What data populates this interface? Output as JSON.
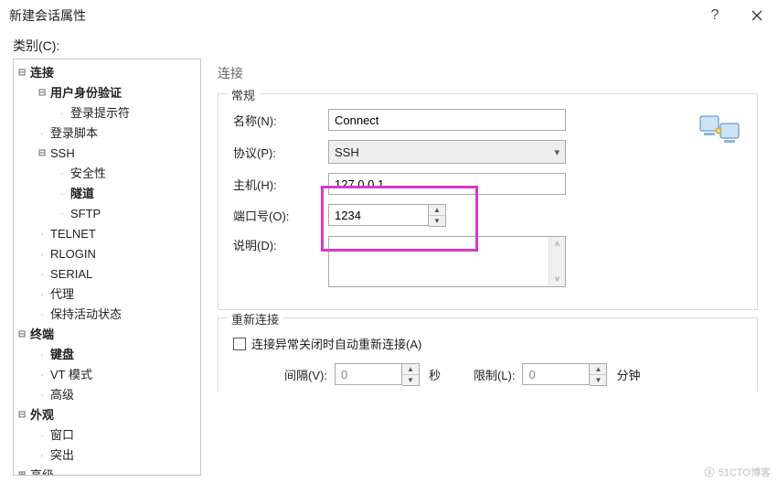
{
  "title": "新建会话属性",
  "category_label": "类别(C):",
  "tree": {
    "connection": "连接",
    "user_auth": "用户身份验证",
    "login_prompt": "登录提示符",
    "login_script": "登录脚本",
    "ssh": "SSH",
    "security": "安全性",
    "tunnel": "隧道",
    "sftp": "SFTP",
    "telnet": "TELNET",
    "rlogin": "RLOGIN",
    "serial": "SERIAL",
    "proxy": "代理",
    "keepalive": "保持活动状态",
    "terminal": "终端",
    "keyboard": "键盘",
    "vtmode": "VT 模式",
    "advanced": "高级",
    "appearance": "外观",
    "window": "窗口",
    "highlight": "突出",
    "advanced2": "高级"
  },
  "panel_caption": "连接",
  "general": {
    "legend": "常规",
    "name_label": "名称(N):",
    "name_value": "Connect",
    "protocol_label": "协议(P):",
    "protocol_value": "SSH",
    "host_label": "主机(H):",
    "host_value": "127.0.0.1",
    "port_label": "端口号(O):",
    "port_value": "1234",
    "desc_label": "说明(D):"
  },
  "reconnect": {
    "legend": "重新连接",
    "checkbox_label": "连接异常关闭时自动重新连接(A)",
    "interval_label": "间隔(V):",
    "interval_value": "0",
    "interval_unit": "秒",
    "limit_label": "限制(L):",
    "limit_value": "0",
    "limit_unit": "分钟"
  },
  "watermark": "51CTO博客"
}
